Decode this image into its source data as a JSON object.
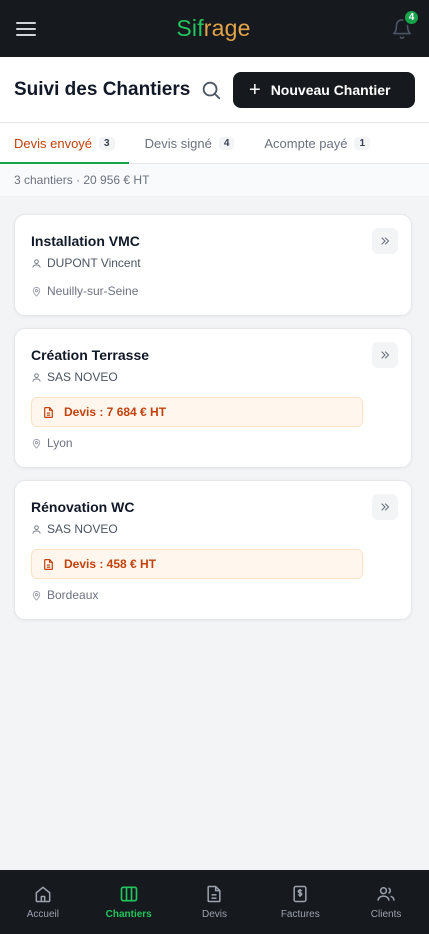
{
  "app": {
    "logo_part1": "Sif",
    "logo_part2": "rage",
    "notification_count": "4"
  },
  "header": {
    "title": "Suivi des Chantiers",
    "new_button_label": "Nouveau Chantier"
  },
  "tabs": [
    {
      "label": "Devis envoyé",
      "count": "3",
      "active": true
    },
    {
      "label": "Devis signé",
      "count": "4",
      "active": false
    },
    {
      "label": "Acompte payé",
      "count": "1",
      "active": false
    }
  ],
  "summary": "3 chantiers · 20 956 € HT",
  "cards": [
    {
      "title": "Installation VMC",
      "client": "DUPONT Vincent",
      "quote": "",
      "location": "Neuilly-sur-Seine"
    },
    {
      "title": "Création Terrasse",
      "client": "SAS NOVEO",
      "quote": "Devis : 7 684 € HT",
      "location": "Lyon"
    },
    {
      "title": "Rénovation WC",
      "client": "SAS NOVEO",
      "quote": "Devis : 458 € HT",
      "location": "Bordeaux"
    }
  ],
  "bottom_nav": [
    {
      "label": "Accueil",
      "icon": "home-icon",
      "active": false
    },
    {
      "label": "Chantiers",
      "icon": "columns-icon",
      "active": true
    },
    {
      "label": "Devis",
      "icon": "document-icon",
      "active": false
    },
    {
      "label": "Factures",
      "icon": "invoice-icon",
      "active": false
    },
    {
      "label": "Clients",
      "icon": "users-icon",
      "active": false
    }
  ],
  "colors": {
    "topbar_bg": "#16191d",
    "brand_green": "#22c55e",
    "brand_orange": "#e0a44a",
    "active_tab_text": "#c2410c",
    "quote_text": "#c2410c",
    "quote_bg": "#fff7ed"
  }
}
